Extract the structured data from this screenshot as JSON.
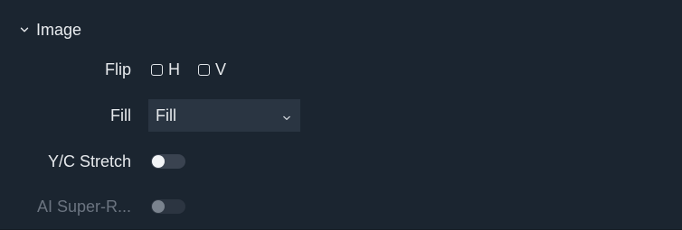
{
  "section": {
    "title": "Image",
    "expanded_icon": "chevron-down-icon"
  },
  "flip": {
    "label": "Flip",
    "options": [
      {
        "label": "H",
        "checked": false
      },
      {
        "label": "V",
        "checked": false
      }
    ]
  },
  "fill": {
    "label": "Fill",
    "value": "Fill"
  },
  "yc_stretch": {
    "label": "Y/C Stretch",
    "on": false
  },
  "ai_super_res": {
    "label": "AI Super-R...",
    "on": false,
    "disabled": true
  },
  "colors": {
    "panel_bg": "#1b2530",
    "select_bg": "#2a3542",
    "text": "#e6e9ec",
    "disabled_text": "#6b7480"
  }
}
